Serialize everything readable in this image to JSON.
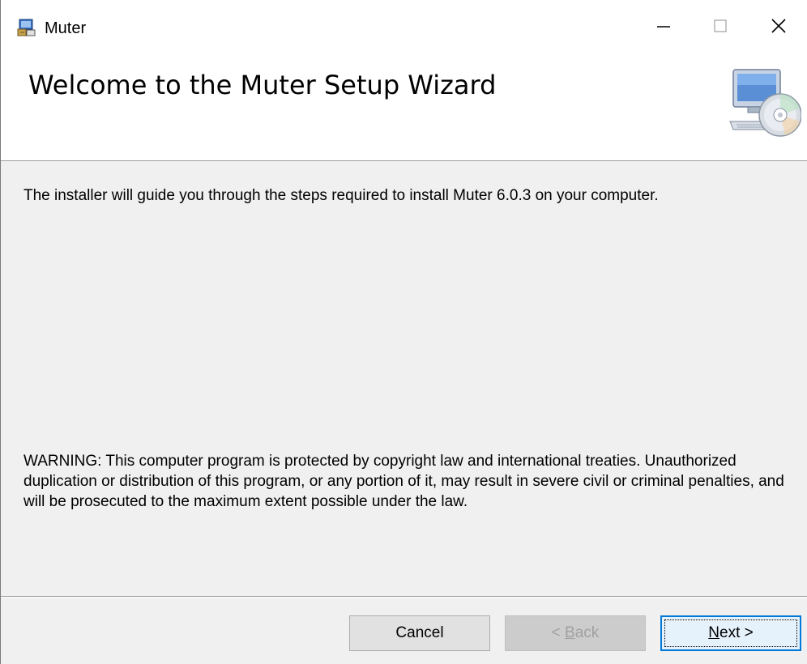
{
  "window": {
    "title": "Muter",
    "controls": {
      "minimize": "—",
      "maximize": "☐",
      "close": "✕"
    },
    "app_icon": "installer-icon"
  },
  "header": {
    "title": "Welcome to the Muter Setup Wizard",
    "graphic": "computer-cd-icon"
  },
  "body": {
    "intro": "The installer will guide you through the steps required to install Muter  6.0.3 on your computer.",
    "warning": "WARNING: This computer program is protected by copyright law and international treaties. Unauthorized duplication or distribution of this program, or any portion of it, may result in severe civil or criminal penalties, and will be prosecuted to the maximum extent possible under the law."
  },
  "buttons": {
    "cancel": "Cancel",
    "back_prefix": "< ",
    "back_mnemonic": "B",
    "back_rest": "ack",
    "next_mnemonic": "N",
    "next_rest": "ext >"
  },
  "colors": {
    "accent": "#0078d7",
    "window_bg": "#f0f0f0",
    "header_bg": "#ffffff"
  }
}
